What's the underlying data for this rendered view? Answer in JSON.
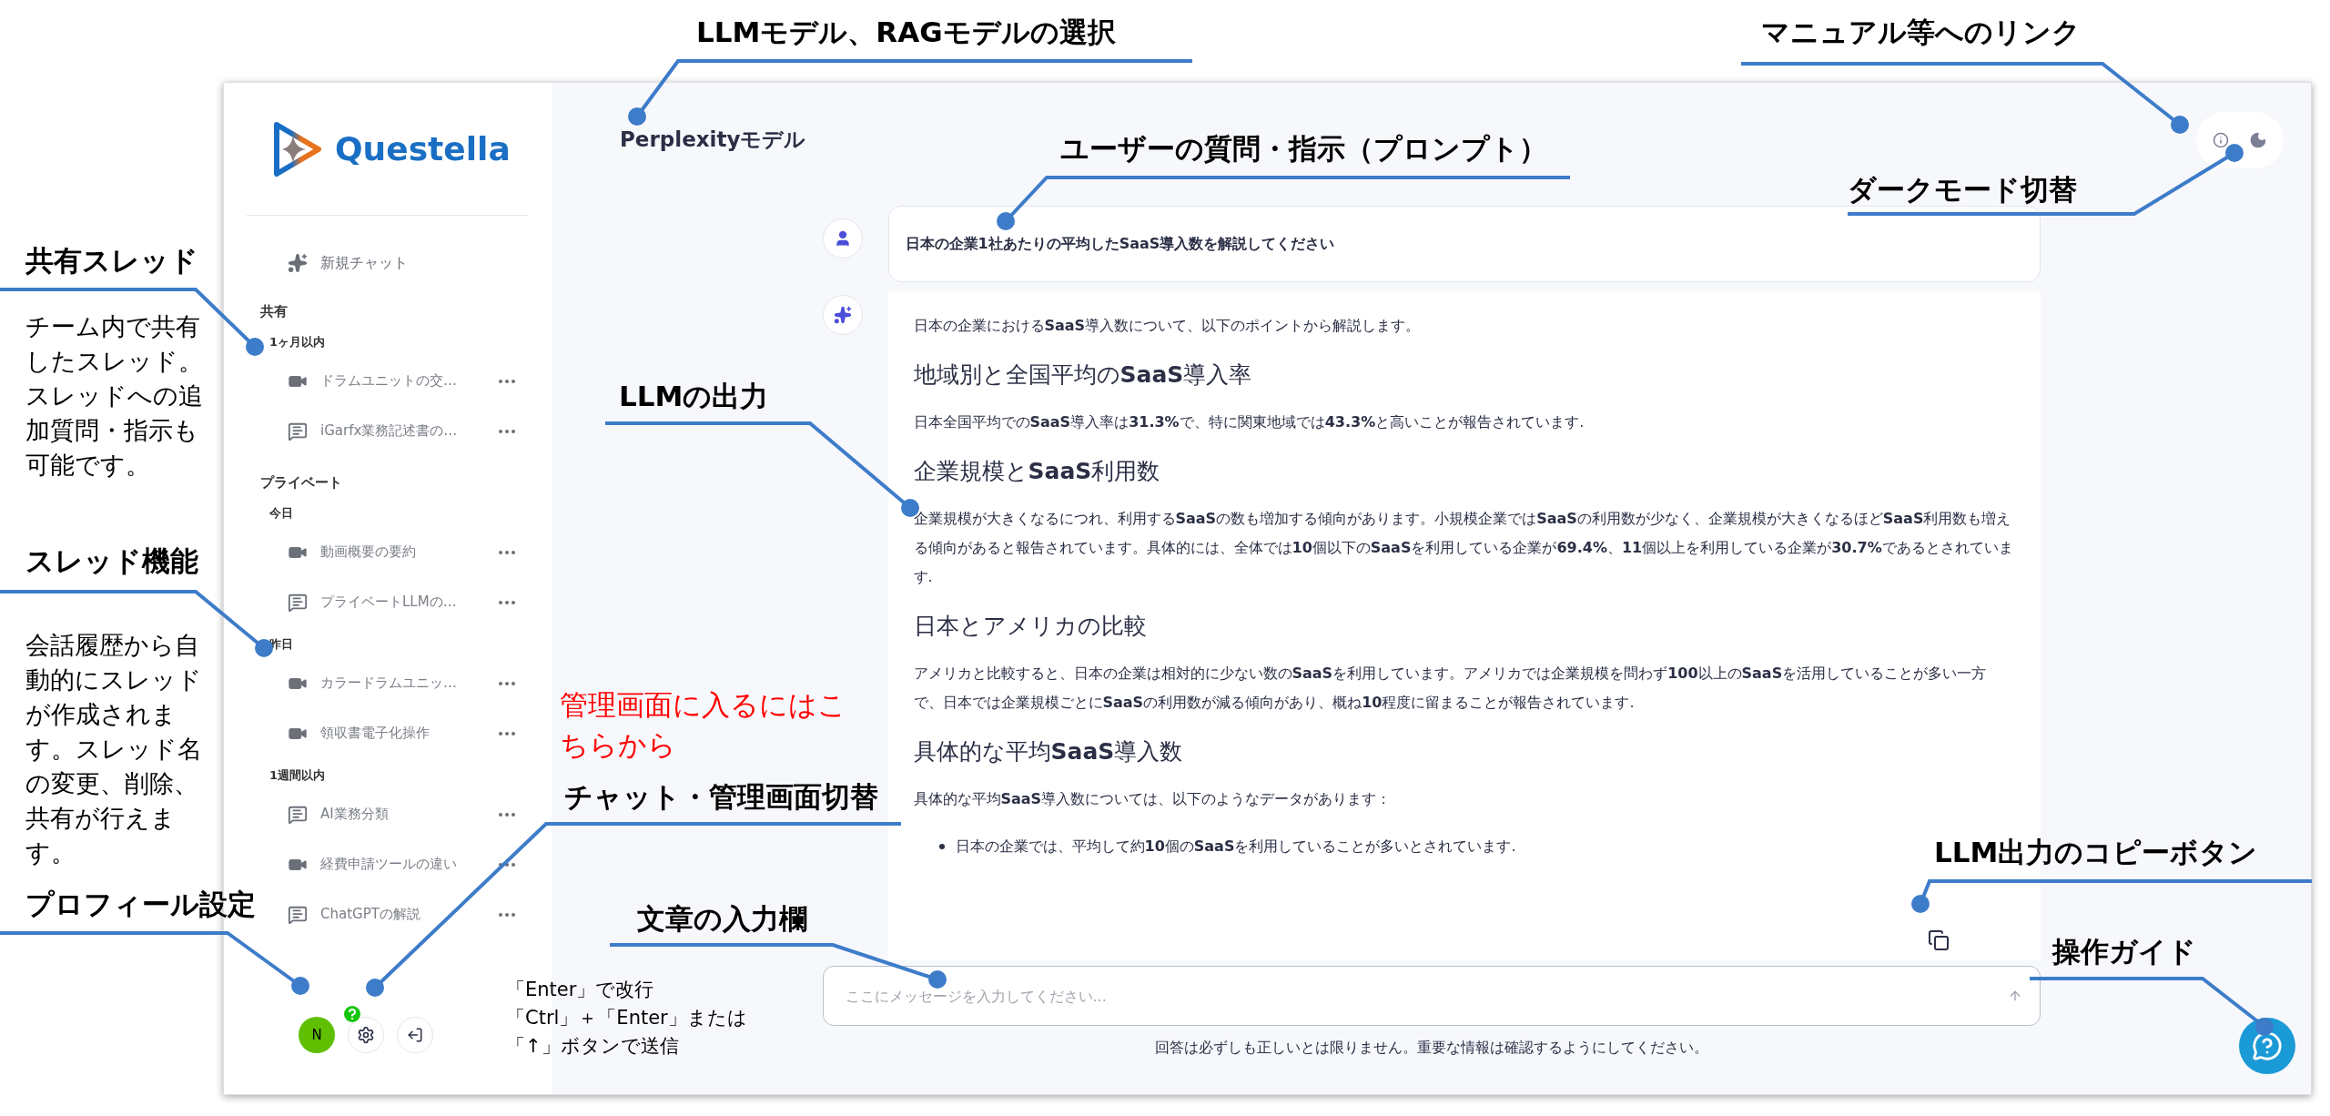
{
  "annotations": [
    {
      "kind": "heading",
      "text": "LLMモデル、RAGモデルの選択"
    },
    {
      "kind": "heading",
      "text": "マニュアル等へのリンク"
    },
    {
      "kind": "heading",
      "text": "ユーザーの質問・指示（プロンプト）"
    },
    {
      "kind": "heading",
      "text": "ダークモード切替"
    },
    {
      "kind": "heading",
      "text": "共有スレッド"
    },
    {
      "kind": "note",
      "text": "チーム内で共有したスレッド。スレッドへの追加質問・指示も可能です。"
    },
    {
      "kind": "heading",
      "text": "LLMの出力"
    },
    {
      "kind": "heading",
      "text": "スレッド機能"
    },
    {
      "kind": "note",
      "text": "会話履歴から自動的にスレッドが作成されます。スレッド名の変更、削除、共有が行えます。"
    },
    {
      "kind": "alert",
      "text": "管理画面に入るにはこちらから"
    },
    {
      "kind": "heading",
      "text": "チャット・管理画面切替"
    },
    {
      "kind": "heading",
      "text": "LLM出力のコピーボタン"
    },
    {
      "kind": "heading",
      "text": "プロフィール設定"
    },
    {
      "kind": "heading",
      "text": "文章の入力欄"
    },
    {
      "kind": "heading",
      "text": "操作ガイド"
    },
    {
      "kind": "lines",
      "lines": [
        "「Enter」で改行",
        "「Ctrl」＋「Enter」または",
        "「↑」ボタンで送信"
      ]
    }
  ],
  "sidebar": {
    "logo": "Questella",
    "new_chat": "新規チャット",
    "sections": [
      {
        "title": "共有",
        "groups": [
          {
            "title": "1ヶ月以内",
            "items": [
              {
                "kind": "video",
                "title": "ドラムユニットの交…"
              },
              {
                "kind": "chat",
                "title": "iGarfx業務記述書の…"
              }
            ]
          }
        ]
      },
      {
        "title": "プライベート",
        "groups": [
          {
            "title": "今日",
            "items": [
              {
                "kind": "video",
                "title": "動画概要の要約"
              },
              {
                "kind": "chat",
                "title": "プライベートLLMの…"
              }
            ]
          },
          {
            "title": "昨日",
            "items": [
              {
                "kind": "video",
                "title": "カラードラムユニッ…"
              },
              {
                "kind": "video",
                "title": "領収書電子化操作"
              }
            ]
          },
          {
            "title": "1週間以内",
            "items": [
              {
                "kind": "chat",
                "title": "AI業務分類"
              },
              {
                "kind": "video",
                "title": "経費申請ツールの違い"
              },
              {
                "kind": "chat",
                "title": "ChatGPTの解説"
              }
            ]
          }
        ]
      }
    ],
    "avatar": "N"
  },
  "header": {
    "model": "Perplexityモデル"
  },
  "messages": [
    {
      "kind": "prompt",
      "text": "日本の企業1社あたりの平均したSaaS導入数を解説してください"
    },
    {
      "kind": "answer",
      "blocks": [
        {
          "kind": "paragraph",
          "text": "日本の企業における**SaaS**導入数について、以下のポイントから解説します。"
        },
        {
          "kind": "heading",
          "text": "地域別と全国平均の**SaaS**導入率"
        },
        {
          "kind": "paragraph",
          "text": "日本全国平均での**SaaS**導入率は**31.3%**で、特に関東地域では**43.3%**と高いことが報告されています."
        },
        {
          "kind": "heading",
          "text": "企業規模と**SaaS**利用数"
        },
        {
          "kind": "paragraph",
          "text": "企業規模が大きくなるにつれ、利用する**SaaS**の数も増加する傾向があります。小規模企業では**SaaS**の利用数が少なく、企業規模が大きくなるほど**SaaS**利用数も増える傾向があると報告されています。具体的には、全体では**10**個以下の**SaaS**を利用している企業が**69.4%**、**11**個以上を利用している企業が**30.7%**であるとされています."
        },
        {
          "kind": "heading",
          "text": "日本とアメリカの比較"
        },
        {
          "kind": "paragraph",
          "text": "アメリカと比較すると、日本の企業は相対的に少ない数の**SaaS**を利用しています。アメリカでは企業規模を問わず**100**以上の**SaaS**を活用していることが多い一方で、日本では企業規模ごとに**SaaS**の利用数が減る傾向があり、概ね**10**程度に留まることが報告されています."
        },
        {
          "kind": "heading",
          "text": "具体的な平均**SaaS**導入数"
        },
        {
          "kind": "paragraph",
          "text": "具体的な平均**SaaS**導入数については、以下のようなデータがあります："
        },
        {
          "kind": "bullet",
          "text": "日本の企業では、平均して約**10**個の**SaaS**を利用していることが多いとされています."
        }
      ]
    }
  ],
  "input": {
    "placeholder": "ここにメッセージを入力してください..."
  },
  "disclaimer": "回答は必ずしも正しいとは限りません。重要な情報は確認するようにしてください。"
}
